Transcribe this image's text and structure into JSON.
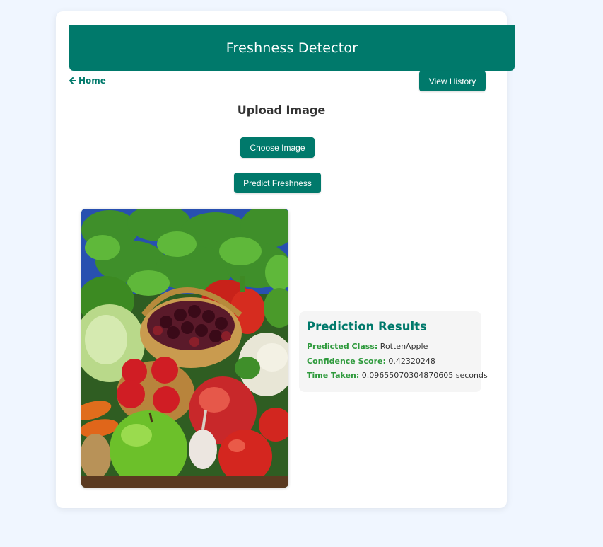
{
  "header": {
    "title": "Freshness Detector"
  },
  "nav": {
    "home_label": "Home",
    "history_label": "View History"
  },
  "upload": {
    "title": "Upload Image",
    "choose_label": "Choose Image",
    "predict_label": "Predict Freshness"
  },
  "image": {
    "alt": "Assorted fresh vegetables and fruits with a basket of cherries"
  },
  "results": {
    "title": "Prediction Results",
    "class_label": "Predicted Class:",
    "class_value": "RottenApple",
    "confidence_label": "Confidence Score:",
    "confidence_value": "0.42320248",
    "time_label": "Time Taken:",
    "time_value": "0.09655070304870605 seconds"
  },
  "colors": {
    "accent": "#00796b",
    "label_green": "#2e9a3c",
    "page_bg": "#f0f6ff",
    "panel_bg": "#f5f5f5"
  },
  "icons": {
    "home": "arrow-left-icon"
  }
}
